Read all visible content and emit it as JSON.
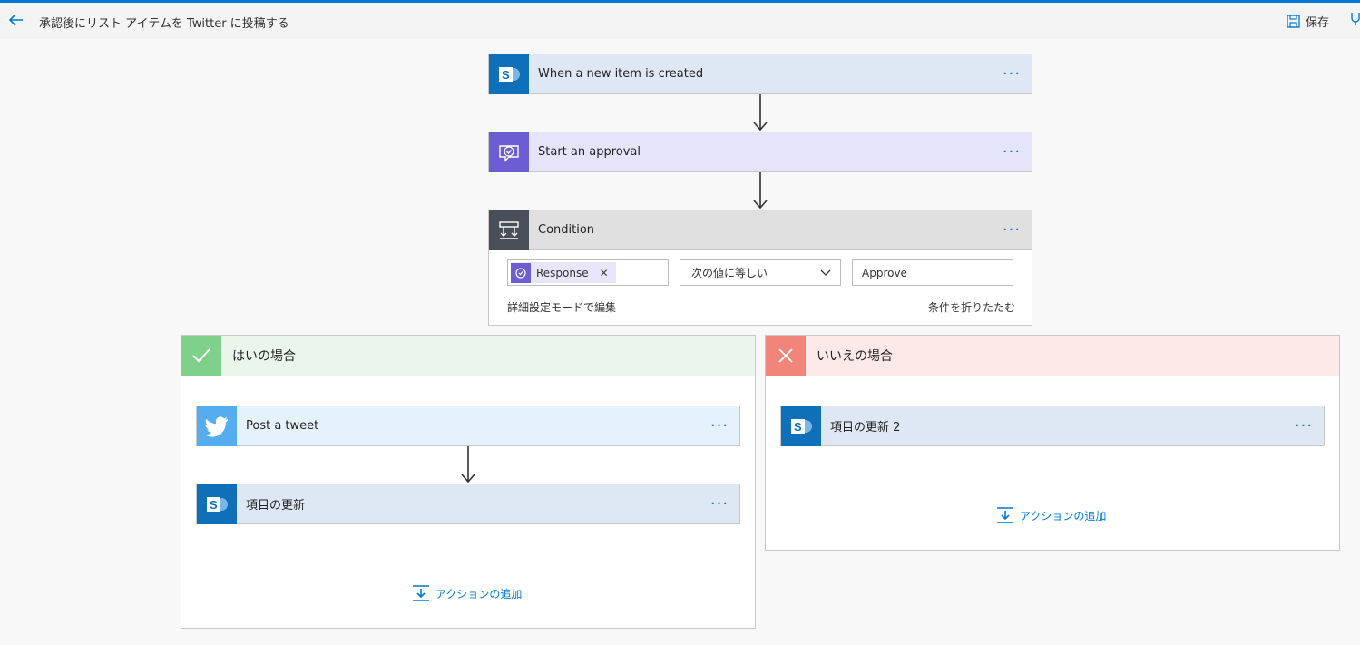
{
  "header": {
    "title": "承認後にリスト アイテムを Twitter に投稿する",
    "save_label": "保存"
  },
  "steps": {
    "trigger": {
      "label": "When a new item is created",
      "icon": "sharepoint-icon"
    },
    "approval": {
      "label": "Start an approval",
      "icon": "approval-icon"
    },
    "condition": {
      "label": "Condition",
      "icon": "condition-icon",
      "token_label": "Response",
      "operator": "次の値に等しい",
      "value": "Approve",
      "advanced_link": "詳細設定モードで編集",
      "collapse_link": "条件を折りたたむ"
    }
  },
  "yes_branch": {
    "label": "はいの場合",
    "actions": [
      {
        "label": "Post a tweet",
        "icon": "twitter-icon"
      },
      {
        "label": "項目の更新",
        "icon": "sharepoint-icon"
      }
    ],
    "add_action": "アクションの追加"
  },
  "no_branch": {
    "label": "いいえの場合",
    "actions": [
      {
        "label": "項目の更新 2",
        "icon": "sharepoint-icon"
      }
    ],
    "add_action": "アクションの追加"
  },
  "colors": {
    "accent": "#0078d4",
    "sharepoint": "#0f6fb8",
    "approval": "#6c5dd3",
    "condition": "#484f58",
    "yes": "#7fd08a",
    "no": "#f2857a"
  }
}
